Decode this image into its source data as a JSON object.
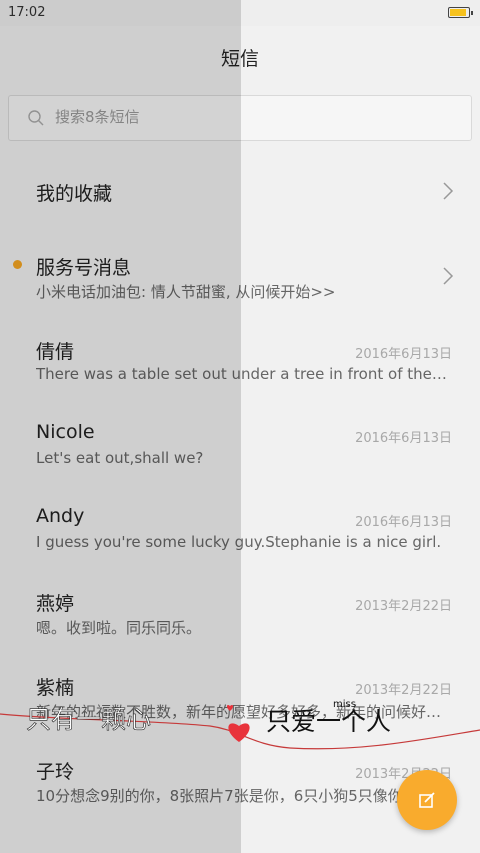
{
  "status": {
    "time": "17:02"
  },
  "header": {
    "title": "短信"
  },
  "search": {
    "placeholder": "搜索8条短信"
  },
  "favorites": {
    "label": "我的收藏"
  },
  "service": {
    "name": "服务号消息",
    "preview": "小米电话加油包: 情人节甜蜜, 从问候开始>>"
  },
  "conversations": [
    {
      "name": "倩倩",
      "date": "2016年6月13日",
      "preview": "There was a table set out under a tree in front of the house"
    },
    {
      "name": "Nicole",
      "date": "2016年6月13日",
      "preview": "Let's eat out,shall we?"
    },
    {
      "name": "Andy",
      "date": "2016年6月13日",
      "preview": "I guess you're some lucky guy.Stephanie is a nice girl."
    },
    {
      "name": "燕婷",
      "date": "2013年2月22日",
      "preview": "嗯。收到啦。同乐同乐。"
    },
    {
      "name": "紫楠",
      "date": "2013年2月22日",
      "preview": "新年的祝福数不胜数，新年的愿望好多好多，新年的问候好多好多"
    },
    {
      "name": "子玲",
      "date": "2013年2月22日",
      "preview": "10分想念9别的你，8张照片7张是你，6只小狗5只像你"
    }
  ],
  "overlay": {
    "left_text": "只有一颗心",
    "right_text": "只爱一个人",
    "small_text": "miss"
  },
  "colors": {
    "accent": "#f9ab2d",
    "dot": "#f5a623",
    "heart": "#e8333b"
  },
  "icons": {
    "search": "search-icon",
    "chevron": "chevron-right-icon",
    "compose": "compose-icon"
  }
}
